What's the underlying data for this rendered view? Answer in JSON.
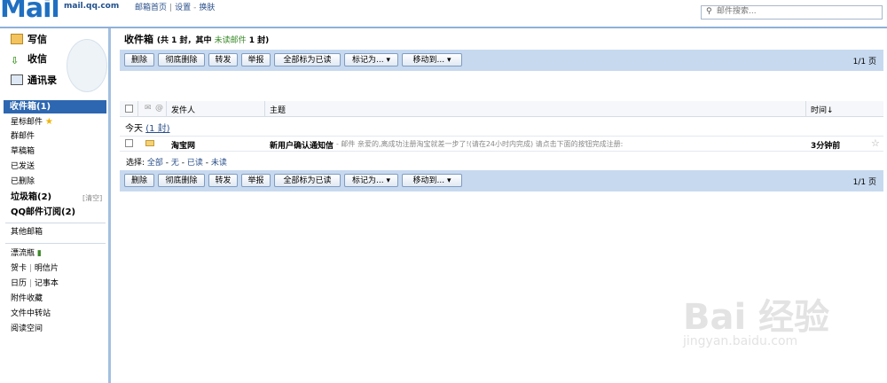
{
  "header": {
    "logo_text": "Mail",
    "logo_domain": "mail.qq.com",
    "links": [
      "邮箱首页",
      "设置",
      "换肤"
    ],
    "search_placeholder": "邮件搜索..."
  },
  "sidebar": {
    "compose": "写信",
    "receive": "收信",
    "contacts": "通讯录",
    "inbox": "收件箱(1)",
    "starred": "星标邮件",
    "group_mail": "群邮件",
    "drafts": "草稿箱",
    "sent": "已发送",
    "deleted": "已删除",
    "spam": "垃圾箱(2)",
    "spam_clean": "[清空]",
    "subscription": "QQ邮件订阅(2)",
    "other_mailbox": "其他邮箱",
    "drift_bottle": "漂流瓶",
    "greeting_card": "贺卡",
    "postcard": "明信片",
    "calendar": "日历",
    "notepad": "记事本",
    "attachments": "附件收藏",
    "file_transfer": "文件中转站",
    "reading_space": "阅读空间"
  },
  "main": {
    "title": "收件箱",
    "summary_prefix": "(共 1 封，其中 ",
    "summary_unread": "未读邮件",
    "summary_suffix": " 1 封)",
    "toolbar": {
      "delete": "删除",
      "delete_permanently": "彻底删除",
      "forward": "转发",
      "report": "举报",
      "mark_all_read": "全部标为已读",
      "mark_as": "标记为...",
      "move_to": "移动到...",
      "page": "1/1 页"
    },
    "columns": {
      "sender": "发件人",
      "subject": "主题",
      "time": "时间↓"
    },
    "group": {
      "label": "今天",
      "count": "(1 封)"
    },
    "rows": [
      {
        "sender": "淘宝网",
        "subject": "新用户确认通知信",
        "preview": "- 邮件 亲爱的,离成功注册淘宝就差一步了!(请在24小时内完成) 请点击下面的按钮完成注册:",
        "time": "3分钟前"
      }
    ],
    "select": {
      "label": "选择:",
      "all": "全部",
      "none": "无",
      "read": "已读",
      "unread": "未读"
    }
  },
  "watermark": {
    "text": "Bai 经验",
    "sub": "jingyan.baidu.com"
  }
}
